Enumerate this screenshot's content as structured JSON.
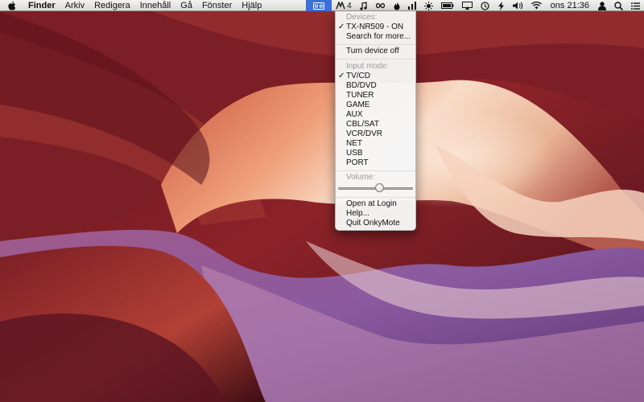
{
  "menubar": {
    "app_name": "Finder",
    "menus": [
      "Arkiv",
      "Redigera",
      "Innehåll",
      "Gå",
      "Fönster",
      "Hjälp"
    ]
  },
  "status": {
    "onkymote_icon": "av-receiver-icon",
    "notification_count": "4",
    "clock": "ons 21:36",
    "icons": [
      "av-receiver-icon",
      "app-4-icon",
      "music-note-icon",
      "infinity-icon",
      "flame-icon",
      "bars-icon",
      "brightness-icon",
      "battery-icon",
      "airplay-icon",
      "time-machine-icon",
      "lightning-icon",
      "volume-icon",
      "wifi-icon",
      "user-icon",
      "search-icon",
      "list-icon"
    ]
  },
  "onkymote_menu": {
    "devices_header": "Devices:",
    "device": "TX-NR509 - ON",
    "device_checked": true,
    "search_more": "Search for more...",
    "turn_off": "Turn device off",
    "input_header": "Input mode:",
    "inputs": [
      "TV/CD",
      "BD/DVD",
      "TUNER",
      "GAME",
      "AUX",
      "CBL/SAT",
      "VCR/DVR",
      "NET",
      "USB",
      "PORT"
    ],
    "selected_input": "TV/CD",
    "volume_header": "Volume:",
    "volume_level_percent": 55,
    "open_at_login": "Open at Login",
    "help": "Help...",
    "quit": "Quit OnkyMote"
  },
  "colors": {
    "menu_highlight": "#3d6fd8",
    "wallpaper_dark": "#6b1d24",
    "wallpaper_light": "#f3d9c9"
  }
}
